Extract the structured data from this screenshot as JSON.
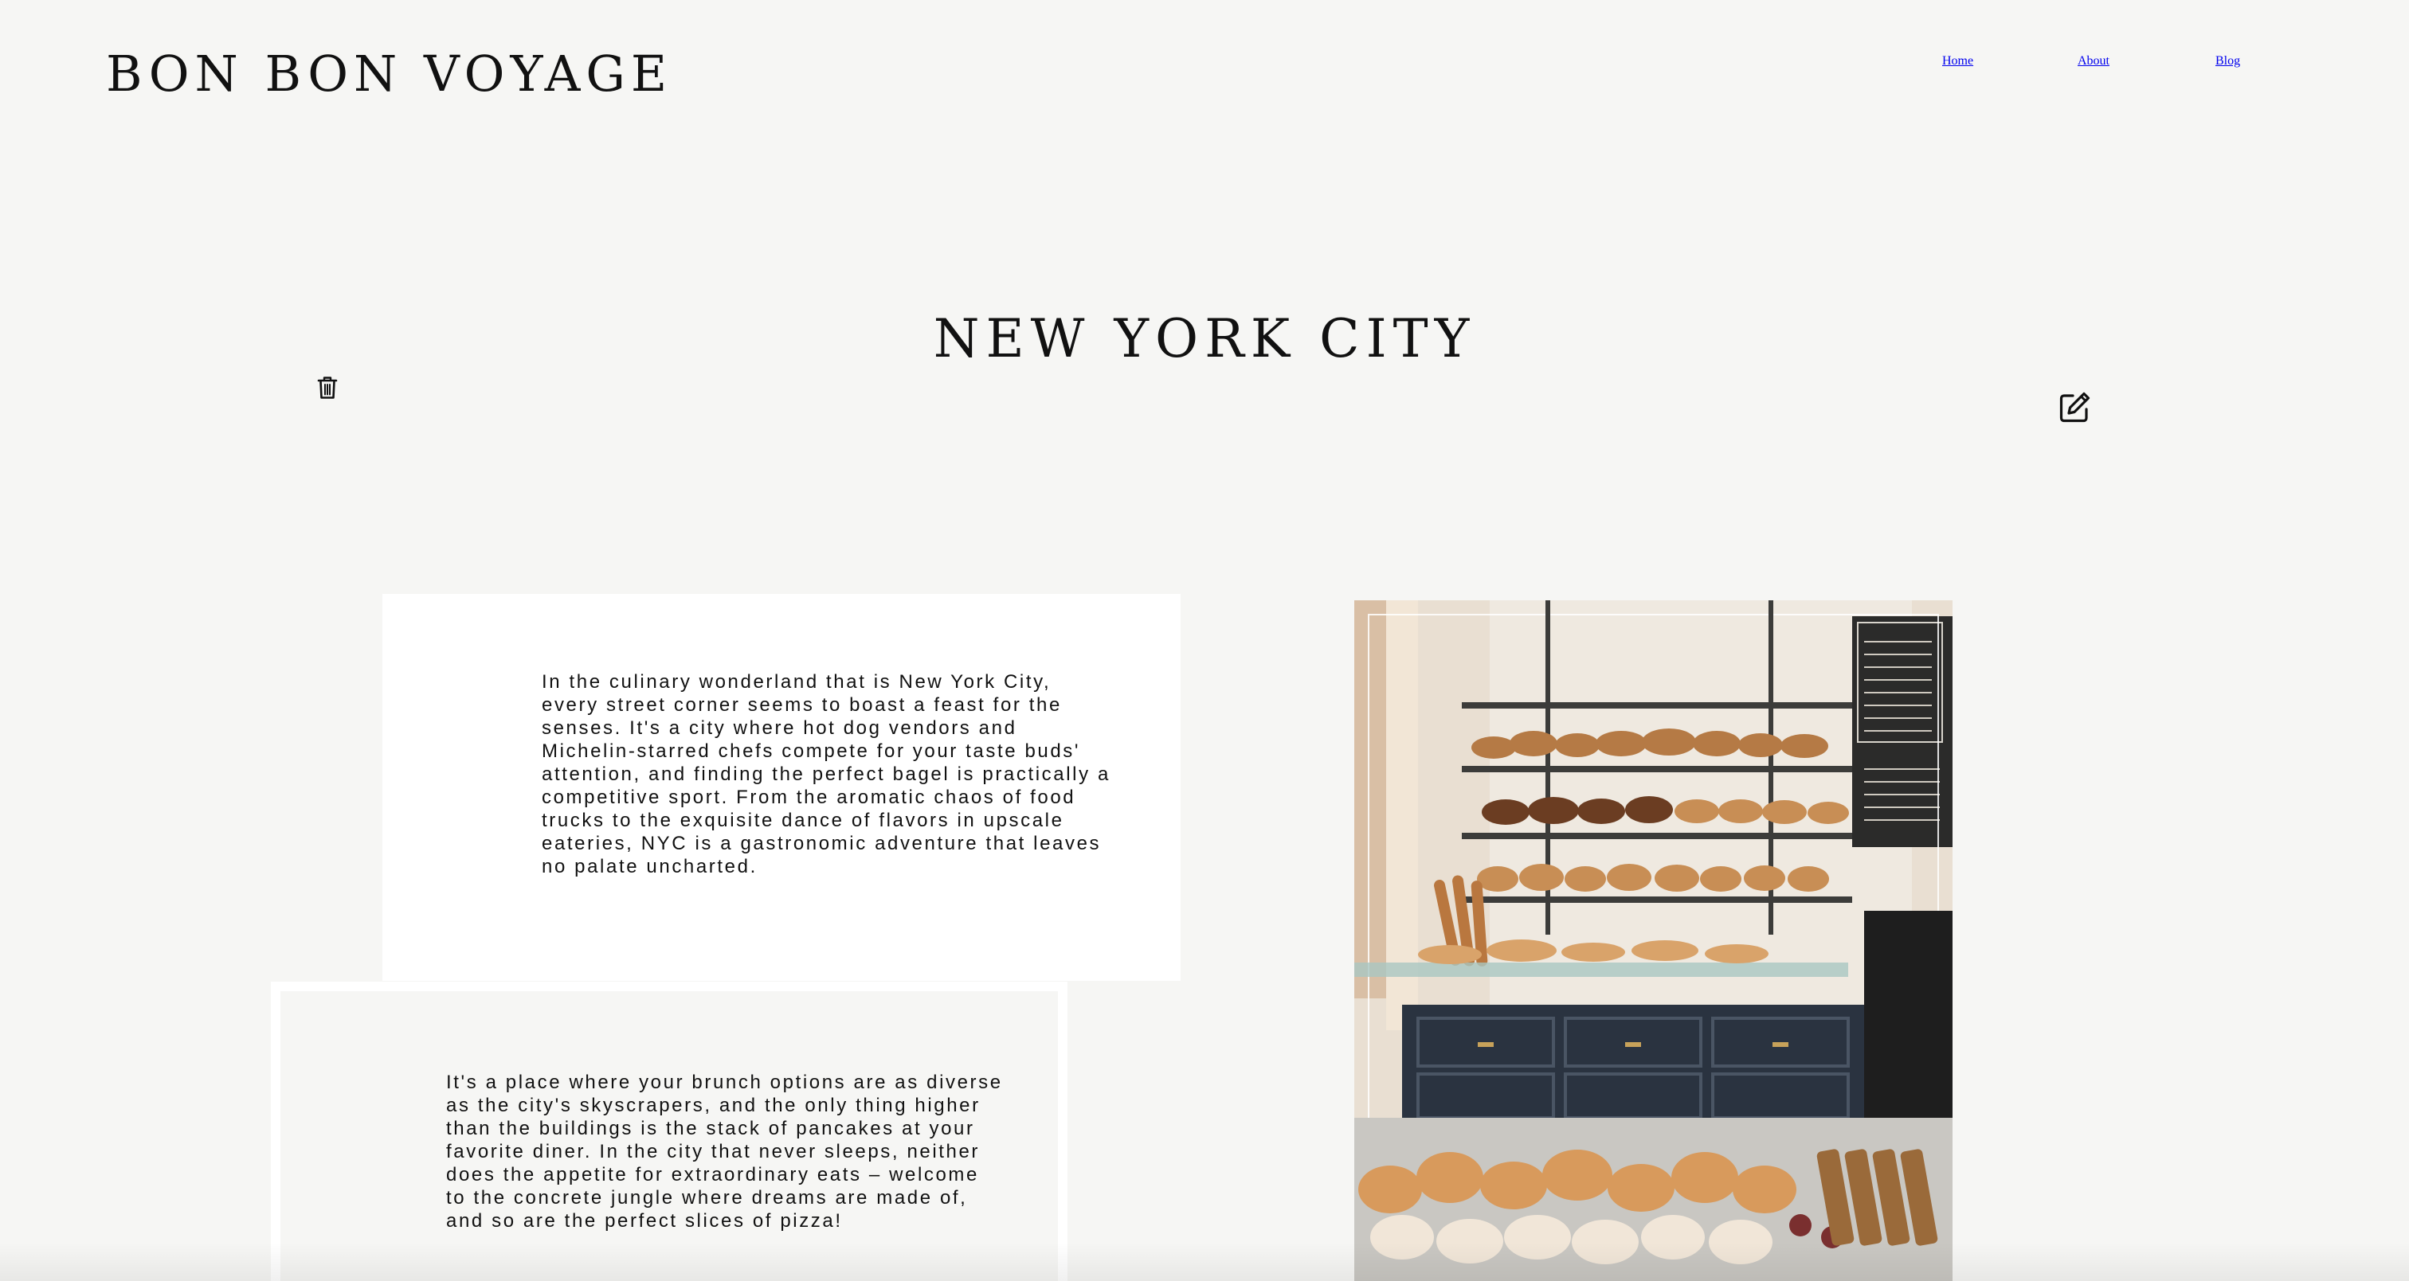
{
  "header": {
    "brand": "BON BON VOYAGE",
    "nav": [
      {
        "label": "Home"
      },
      {
        "label": "About"
      },
      {
        "label": "Blog"
      }
    ]
  },
  "post": {
    "title": "NEW YORK CITY",
    "actions": {
      "delete_icon": "trash-icon",
      "edit_icon": "edit-icon"
    },
    "paragraphs": [
      {
        "text": "In the culinary wonderland that is New York City, every street corner seems to boast a feast for the senses. It's a city where hot dog vendors and Michelin-starred chefs compete for your taste buds' attention, and finding the perfect bagel is practically a competitive sport. From the aromatic chaos of food trucks to the exquisite dance of flavors in upscale eateries, NYC is a gastronomic adventure that leaves no palate uncharted."
      },
      {
        "text": "It's a place where your brunch options are as diverse as the city's skyscrapers, and the only thing higher than the buildings is the stack of pancakes at your favorite diner. In the city that never sleeps, neither does the appetite for extraordinary eats – welcome to the concrete jungle where dreams are made of, and so are the perfect slices of pizza!"
      }
    ]
  },
  "colors": {
    "background": "#f6f6f4",
    "panel": "#ffffff",
    "text": "#111111"
  }
}
